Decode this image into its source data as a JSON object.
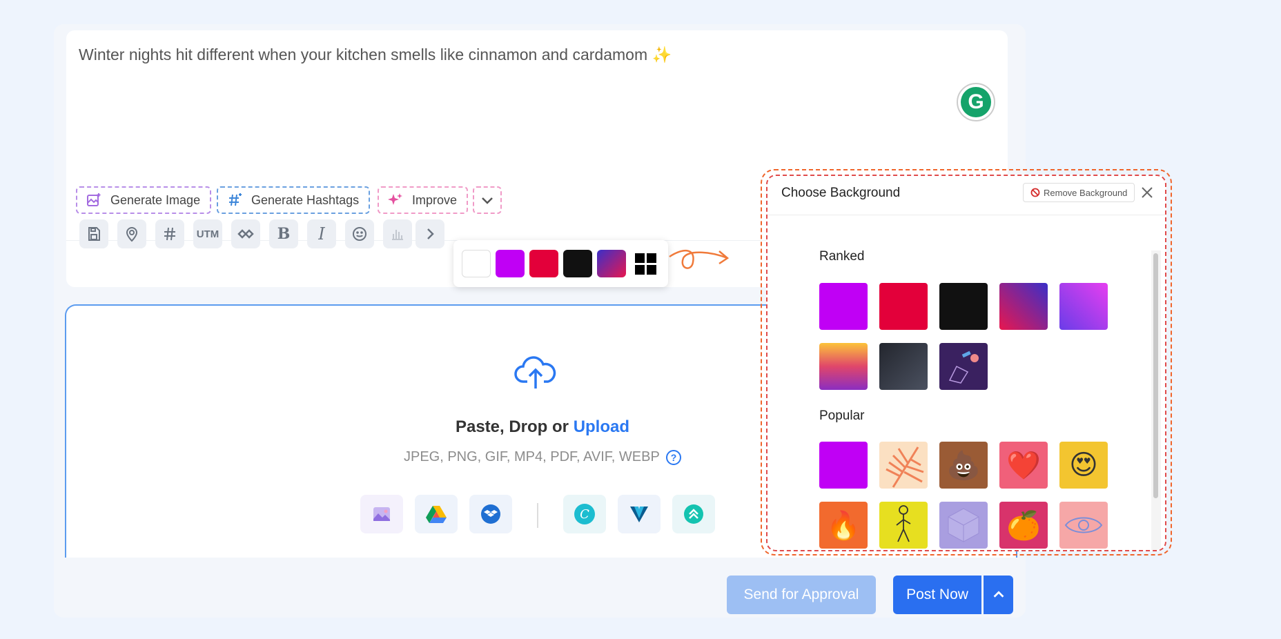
{
  "editor": {
    "post_text": "Winter nights hit different when your kitchen smells like cinnamon and cardamom ✨",
    "grammarly_letter": "G"
  },
  "ai_actions": {
    "generate_image": "Generate Image",
    "generate_hashtags": "Generate Hashtags",
    "improve": "Improve"
  },
  "toolbar": {
    "utm_label": "UTM",
    "bold_label": "B",
    "italic_label": "I"
  },
  "color_picker": {
    "swatches": [
      "#ffffff",
      "#c000f5",
      "#e3003a",
      "#111111",
      "gradient-purple-red"
    ]
  },
  "upload": {
    "title_prefix": "Paste, Drop or ",
    "title_link": "Upload",
    "types": "JPEG, PNG, GIF, MP4, PDF, AVIF, WEBP",
    "help": "?"
  },
  "footer": {
    "send_for_approval": "Send for Approval",
    "post_now": "Post Now"
  },
  "background_panel": {
    "title": "Choose Background",
    "remove_label": "Remove Background",
    "sections": {
      "ranked": "Ranked",
      "popular": "Popular"
    },
    "popular_emojis": [
      "",
      "",
      "💩",
      "❤️",
      "😍",
      "🔥",
      "",
      "",
      "🍊",
      "👁"
    ]
  },
  "colors": {
    "accent": "#2a6ff0",
    "panel_border": "#f0642a",
    "ai_image_border": "#b88ee8",
    "ai_hashtag_border": "#6aa0e0",
    "ai_improve_border": "#f09ac7"
  }
}
